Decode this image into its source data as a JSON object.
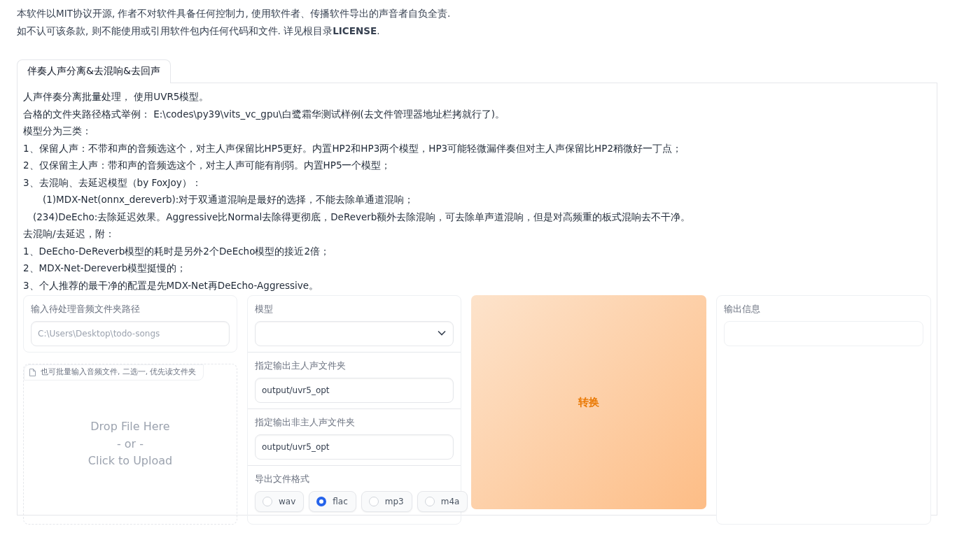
{
  "notice": [
    "本软件以MIT协议开源, 作者不对软件具备任何控制力, 使用软件者、传播软件导出的声音者自负全责.",
    "如不认可该条款, 则不能使用或引用软件包内任何代码和文件. 详见根目录**LICENSE**."
  ],
  "tabs": [
    {
      "label": "伴奏人声分离&去混响&去回声",
      "selected": true
    }
  ],
  "description": [
    {
      "kind": "plain",
      "text": "人声伴奏分离批量处理， 使用UVR5模型。"
    },
    {
      "kind": "plain",
      "text": "合格的文件夹路径格式举例： E:\\codes\\py39\\vits_vc_gpu\\白鹭霜华测试样例(去文件管理器地址栏拷就行了)。"
    },
    {
      "kind": "plain",
      "text": "模型分为三类："
    },
    {
      "kind": "plain",
      "text": "1、保留人声：不带和声的音频选这个，对主人声保留比HP5更好。内置HP2和HP3两个模型，HP3可能轻微漏伴奏但对主人声保留比HP2稍微好一丁点；"
    },
    {
      "kind": "plain",
      "text": "2、仅保留主人声：带和声的音频选这个，对主人声可能有削弱。内置HP5一个模型；"
    },
    {
      "kind": "plain",
      "text": "3、去混响、去延迟模型（by FoxJoy）："
    },
    {
      "kind": "deep",
      "text": "(1)MDX-Net(onnx_dereverb):对于双通道混响是最好的选择，不能去除单通道混响；"
    },
    {
      "kind": "shallow",
      "text": "(234)DeEcho:去除延迟效果。Aggressive比Normal去除得更彻底，DeReverb额外去除混响，可去除单声道混响，但是对高频重的板式混响去不干净。"
    },
    {
      "kind": "plain",
      "text": "去混响/去延迟，附："
    },
    {
      "kind": "plain",
      "text": "1、DeEcho-DeReverb模型的耗时是另外2个DeEcho模型的接近2倍；"
    },
    {
      "kind": "plain",
      "text": "2、MDX-Net-Dereverb模型挺慢的；"
    },
    {
      "kind": "plain",
      "text": "3、个人推荐的最干净的配置是先MDX-Net再DeEcho-Aggressive。"
    }
  ],
  "input_folder": {
    "label": "输入待处理音频文件夹路径",
    "placeholder": "C:\\Users\\Desktop\\todo-songs"
  },
  "file_upload": {
    "label": "也可批量输入音频文件, 二选一, 优先读文件夹",
    "drop_text": [
      "Drop File Here",
      "- or -",
      "Click to Upload"
    ]
  },
  "model": {
    "label": "模型"
  },
  "vocal_folder": {
    "label": "指定输出主人声文件夹",
    "value": "output/uvr5_opt"
  },
  "other_folder": {
    "label": "指定输出非主人声文件夹",
    "value": "output/uvr5_opt"
  },
  "format": {
    "label": "导出文件格式",
    "options": [
      {
        "label": "wav",
        "selected": false
      },
      {
        "label": "flac",
        "selected": true
      },
      {
        "label": "mp3",
        "selected": false
      },
      {
        "label": "m4a",
        "selected": false
      }
    ]
  },
  "convert_button": {
    "label": "转换"
  },
  "output_info": {
    "label": "输出信息"
  }
}
